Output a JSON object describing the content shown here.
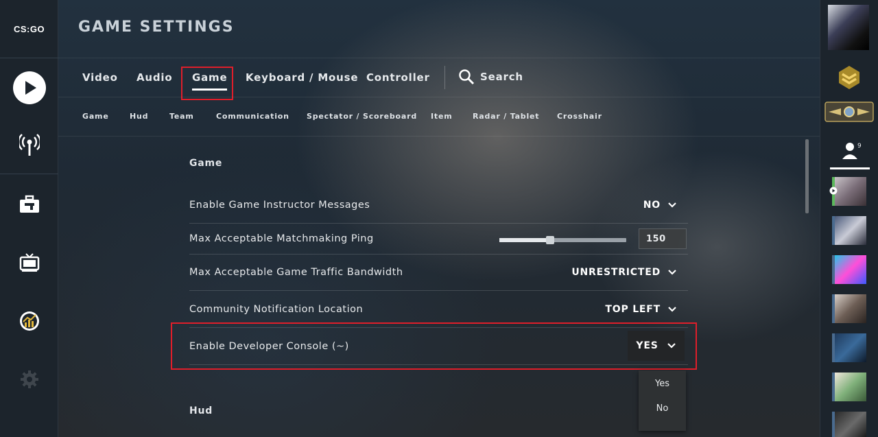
{
  "app": {
    "logo": "CS:GO",
    "page_title": "GAME SETTINGS"
  },
  "left_nav": [
    {
      "name": "play-icon"
    },
    {
      "name": "broadcast-icon"
    },
    {
      "name": "inventory-icon"
    },
    {
      "name": "watch-icon"
    },
    {
      "name": "stats-icon"
    },
    {
      "name": "gear-icon"
    }
  ],
  "tabs": [
    "Video",
    "Audio",
    "Game",
    "Keyboard / Mouse",
    "Controller"
  ],
  "active_tab": "Game",
  "search": {
    "label": "Search",
    "icon": "search-icon"
  },
  "subtabs": [
    "Game",
    "Hud",
    "Team",
    "Communication",
    "Spectator / Scoreboard",
    "Item",
    "Radar / Tablet",
    "Crosshair"
  ],
  "sections": {
    "game_title": "Game",
    "hud_title": "Hud"
  },
  "settings": {
    "instructor": {
      "label": "Enable Game Instructor Messages",
      "value": "NO"
    },
    "ping": {
      "label": "Max Acceptable Matchmaking Ping",
      "value": "150",
      "slider_fraction": 0.4
    },
    "bandwidth": {
      "label": "Max Acceptable Game Traffic Bandwidth",
      "value": "UNRESTRICTED"
    },
    "notification": {
      "label": "Community Notification Location",
      "value": "TOP LEFT"
    },
    "console": {
      "label": "Enable Developer Console (~)",
      "value": "YES"
    }
  },
  "console_dropdown": {
    "options": [
      "Yes",
      "No"
    ]
  },
  "friends": {
    "count": "9"
  },
  "colors": {
    "highlight": "#e01e2a",
    "accent": "#ffffff"
  }
}
